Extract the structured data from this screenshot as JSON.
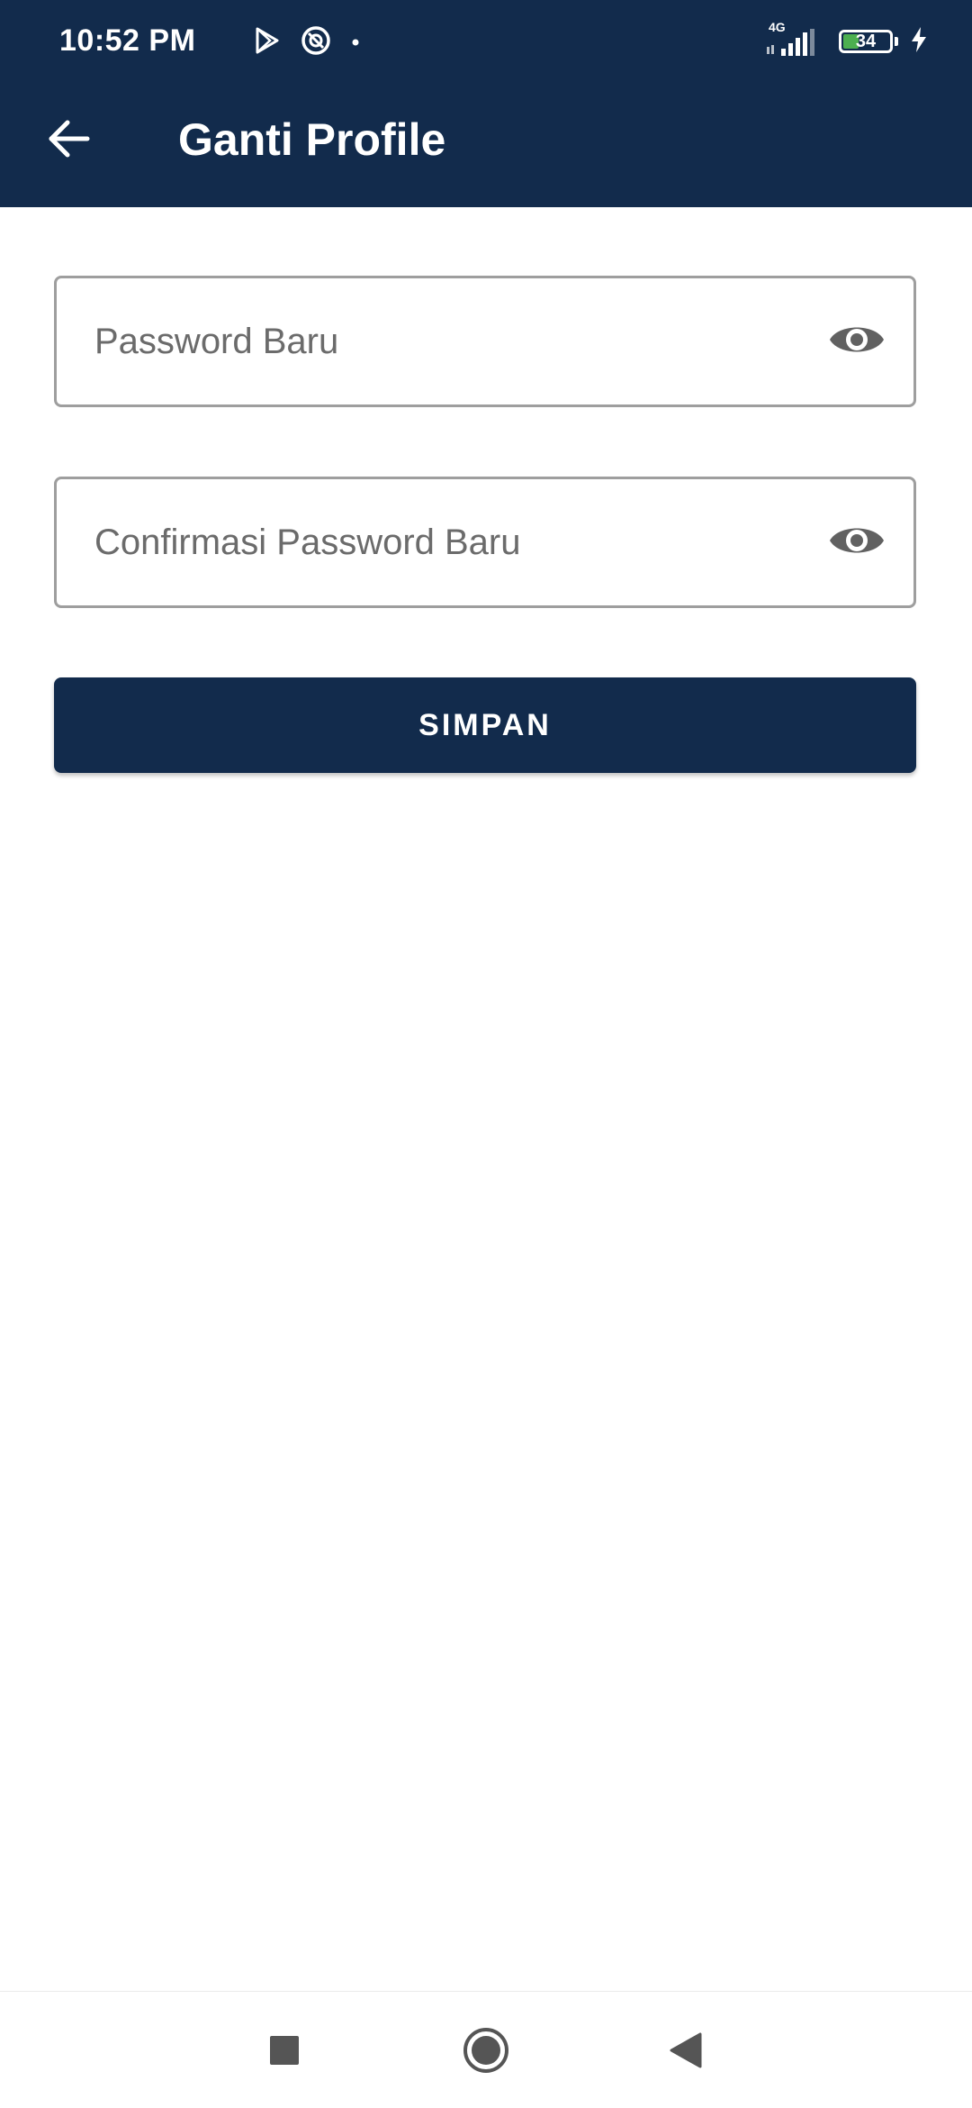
{
  "status_bar": {
    "time": "10:52 PM",
    "network_label": "4G",
    "battery_level": "34",
    "battery_fraction": 0.34,
    "icons": [
      "play-store-icon",
      "hotspot-icon",
      "notification-dot-icon",
      "signal-icon",
      "battery-icon",
      "charging-icon"
    ]
  },
  "app_bar": {
    "title": "Ganti Profile",
    "back_icon": "arrow-left-icon"
  },
  "form": {
    "new_password": {
      "placeholder": "Password Baru",
      "value": "",
      "toggle_icon": "eye-icon"
    },
    "confirm_password": {
      "placeholder": "Confirmasi Password Baru",
      "value": "",
      "toggle_icon": "eye-icon"
    },
    "save_label": "SIMPAN"
  },
  "nav_bar": {
    "icons": [
      "recents-square-icon",
      "home-circle-icon",
      "back-triangle-icon"
    ]
  },
  "colors": {
    "primary": "#122b4c",
    "field_border": "#9e9e9e",
    "placeholder": "#6b6b6b",
    "icon_gray": "#616161",
    "background": "#ffffff",
    "battery_green": "#4caf50"
  }
}
